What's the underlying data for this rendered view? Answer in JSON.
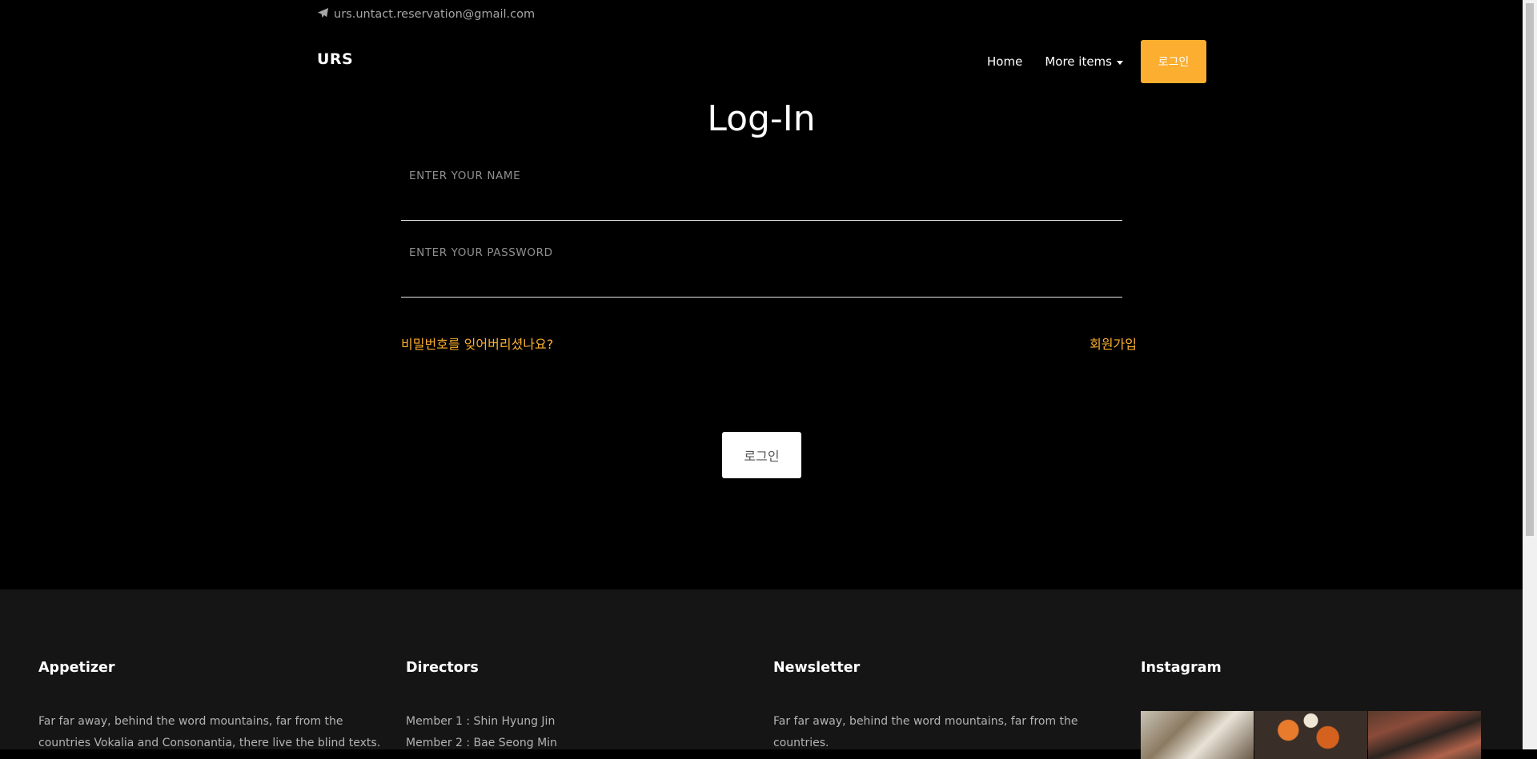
{
  "header": {
    "email": "urs.untact.reservation@gmail.com",
    "brand": "URS",
    "nav": {
      "home": "Home",
      "more_items": "More items",
      "login_button": "로그인"
    }
  },
  "login": {
    "title": "Log-In",
    "name_placeholder": "ENTER YOUR NAME",
    "password_placeholder": "ENTER YOUR PASSWORD",
    "forgot_password": "비밀번호를 잊어버리셨나요?",
    "signup": "회원가입",
    "submit": "로그인"
  },
  "footer": {
    "appetizer": {
      "heading": "Appetizer",
      "text": "Far far away, behind the word mountains, far from the countries Vokalia and Consonantia, there live the blind texts."
    },
    "directors": {
      "heading": "Directors",
      "members": [
        "Member 1 : Shin Hyung Jin",
        "Member 2 : Bae Seong Min"
      ]
    },
    "newsletter": {
      "heading": "Newsletter",
      "text": "Far far away, behind the word mountains, far from the countries."
    },
    "instagram": {
      "heading": "Instagram"
    }
  },
  "colors": {
    "accent": "#fbae2f",
    "background": "#000000",
    "footer_bg": "#151515"
  }
}
